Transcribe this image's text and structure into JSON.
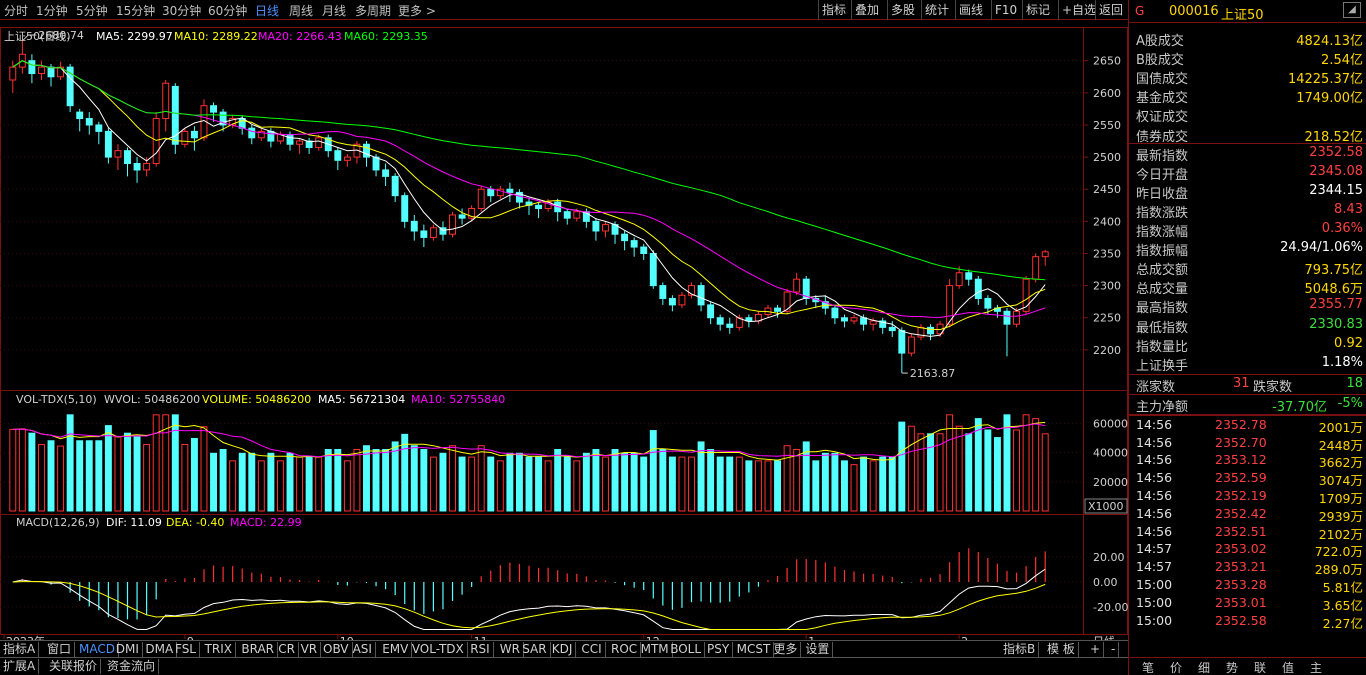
{
  "toolbar": {
    "left_tabs": [
      "分时",
      "1分钟",
      "5分钟",
      "15分钟",
      "30分钟",
      "60分钟",
      "日线",
      "周线",
      "月线",
      "多周期",
      "更多 >"
    ],
    "active_tab": "日线",
    "right_tabs": [
      "指标",
      "叠加",
      "多股",
      "统计",
      "画线",
      "F10",
      "标记",
      "+自选",
      "返回"
    ]
  },
  "price_panel": {
    "title": "上证50(日线)",
    "ma5_label": "MA5: 2299.97",
    "ma10_label": "MA10: 2289.22",
    "ma20_label": "MA20: 2266.43",
    "ma60_label": "MA60: 2293.35",
    "high_marker": "2680.74",
    "low_marker": "2163.87",
    "y_ticks": [
      "2650",
      "2600",
      "2550",
      "2500",
      "2450",
      "2400",
      "2350",
      "2300",
      "2250",
      "2200"
    ]
  },
  "volume_panel": {
    "label_main": "VOL-TDX(5,10)",
    "wvol": "WVOL: 50486200",
    "volume": "VOLUME: 50486200",
    "ma5": "MA5: 56721304",
    "ma10": "MA10: 52755840",
    "y_ticks": [
      "60000",
      "40000",
      "20000"
    ],
    "unit": "X1000"
  },
  "macd_panel": {
    "label_main": "MACD(12,26,9)",
    "dif": "DIF: 11.09",
    "dea": "DEA: -0.40",
    "macd": "MACD: 22.99",
    "y_ticks": [
      "20.00",
      "0.00",
      "-20.00"
    ]
  },
  "x_axis": {
    "labels": [
      "2023年",
      "9",
      "10",
      "11",
      "12",
      "1",
      "2"
    ],
    "period": "日线"
  },
  "bottom_tabs": [
    "指标A",
    "窗口",
    "MACD",
    "DMI",
    "DMA",
    "FSL",
    "TRIX",
    "BRAR",
    "CR",
    "VR",
    "OBV",
    "ASI",
    "EMV",
    "VOL-TDX",
    "RSI",
    "WR",
    "SAR",
    "KDJ",
    "CCI",
    "ROC",
    "MTM",
    "BOLL",
    "PSY",
    "MCST",
    "更多",
    "设置"
  ],
  "bottom_tabs_right": [
    "指标B",
    "模 板",
    "+",
    "-"
  ],
  "bottom_tabs2": [
    "扩展A",
    "关联报价",
    "资金流向"
  ],
  "right_panel": {
    "header_icon": "G",
    "code": "000016",
    "name": "上证50",
    "stats": [
      {
        "label": "A股成交",
        "value": "4824.13亿",
        "color": "yel"
      },
      {
        "label": "B股成交",
        "value": "2.54亿",
        "color": "yel"
      },
      {
        "label": "国债成交",
        "value": "14225.37亿",
        "color": "yel"
      },
      {
        "label": "基金成交",
        "value": "1749.00亿",
        "color": "yel"
      },
      {
        "label": "权证成交",
        "value": "",
        "color": "yel"
      },
      {
        "label": "债券成交",
        "value": "218.52亿",
        "color": "yel"
      },
      {
        "label": "最新指数",
        "value": "2352.58",
        "color": "red"
      },
      {
        "label": "今日开盘",
        "value": "2345.08",
        "color": "red"
      },
      {
        "label": "昨日收盘",
        "value": "2344.15",
        "color": "white"
      },
      {
        "label": "指数涨跌",
        "value": "8.43",
        "color": "red"
      },
      {
        "label": "指数涨幅",
        "value": "0.36%",
        "color": "red"
      },
      {
        "label": "指数振幅",
        "value": "24.94/1.06%",
        "color": "white"
      },
      {
        "label": "总成交额",
        "value": "793.75亿",
        "color": "yel"
      },
      {
        "label": "总成交量",
        "value": "5048.6万",
        "color": "yel"
      },
      {
        "label": "最高指数",
        "value": "2355.77",
        "color": "red"
      },
      {
        "label": "最低指数",
        "value": "2330.83",
        "color": "green"
      },
      {
        "label": "指数量比",
        "value": "0.92",
        "color": "yel"
      },
      {
        "label": "上证换手",
        "value": "1.18%",
        "color": "white"
      }
    ],
    "up_label": "涨家数",
    "up_value": "31",
    "down_label": "跌家数",
    "down_value": "18",
    "main_flow_label": "主力净额",
    "main_flow_value": "-37.70亿",
    "main_flow_pct": "-5%",
    "ticks": [
      {
        "time": "14:56",
        "price": "2352.78",
        "vol": "2001万"
      },
      {
        "time": "14:56",
        "price": "2352.70",
        "vol": "2448万"
      },
      {
        "time": "14:56",
        "price": "2353.12",
        "vol": "3662万"
      },
      {
        "time": "14:56",
        "price": "2352.59",
        "vol": "3074万"
      },
      {
        "time": "14:56",
        "price": "2352.19",
        "vol": "1709万"
      },
      {
        "time": "14:56",
        "price": "2352.42",
        "vol": "2939万"
      },
      {
        "time": "14:56",
        "price": "2352.51",
        "vol": "2102万"
      },
      {
        "time": "14:57",
        "price": "2353.02",
        "vol": "722.0万"
      },
      {
        "time": "14:57",
        "price": "2353.21",
        "vol": "289.0万"
      },
      {
        "time": "15:00",
        "price": "2353.28",
        "vol": "5.81亿"
      },
      {
        "time": "15:00",
        "price": "2353.01",
        "vol": "3.65亿"
      },
      {
        "time": "15:00",
        "price": "2352.58",
        "vol": "2.27亿"
      }
    ],
    "bottom_tabs": [
      "笔",
      "价",
      "细",
      "势",
      "联",
      "值",
      "主"
    ]
  },
  "colors": {
    "up": "#ff3030",
    "down": "#54ffff",
    "ma5": "#ffffff",
    "ma10": "#ffff00",
    "ma20": "#ff00ff",
    "ma60": "#00ff00",
    "grid": "#7a1010"
  },
  "chart_data": {
    "type": "candlestick",
    "ylim": [
      2150,
      2690
    ],
    "candles": [
      [
        2620,
        2640,
        2600,
        2650
      ],
      [
        2640,
        2660,
        2630,
        2680.74
      ],
      [
        2650,
        2630,
        2615,
        2660
      ],
      [
        2630,
        2640,
        2620,
        2650
      ],
      [
        2640,
        2625,
        2610,
        2645
      ],
      [
        2625,
        2640,
        2620,
        2648
      ],
      [
        2640,
        2580,
        2570,
        2645
      ],
      [
        2570,
        2560,
        2540,
        2575
      ],
      [
        2560,
        2550,
        2535,
        2570
      ],
      [
        2550,
        2540,
        2520,
        2555
      ],
      [
        2540,
        2500,
        2490,
        2545
      ],
      [
        2500,
        2510,
        2480,
        2520
      ],
      [
        2510,
        2490,
        2470,
        2515
      ],
      [
        2490,
        2480,
        2460,
        2500
      ],
      [
        2480,
        2490,
        2470,
        2500
      ],
      [
        2490,
        2560,
        2485,
        2570
      ],
      [
        2560,
        2615,
        2540,
        2620
      ],
      [
        2610,
        2520,
        2505,
        2615
      ],
      [
        2520,
        2540,
        2515,
        2545
      ],
      [
        2540,
        2530,
        2510,
        2548
      ],
      [
        2530,
        2580,
        2525,
        2590
      ],
      [
        2580,
        2570,
        2555,
        2585
      ],
      [
        2570,
        2550,
        2540,
        2575
      ],
      [
        2550,
        2560,
        2545,
        2565
      ],
      [
        2560,
        2545,
        2535,
        2565
      ],
      [
        2545,
        2530,
        2520,
        2550
      ],
      [
        2530,
        2540,
        2525,
        2545
      ],
      [
        2540,
        2525,
        2515,
        2545
      ],
      [
        2525,
        2535,
        2520,
        2540
      ],
      [
        2535,
        2520,
        2510,
        2540
      ],
      [
        2520,
        2525,
        2505,
        2530
      ],
      [
        2525,
        2515,
        2505,
        2530
      ],
      [
        2515,
        2530,
        2510,
        2535
      ],
      [
        2530,
        2510,
        2500,
        2535
      ],
      [
        2510,
        2495,
        2480,
        2515
      ],
      [
        2495,
        2500,
        2485,
        2505
      ],
      [
        2500,
        2520,
        2490,
        2525
      ],
      [
        2520,
        2500,
        2485,
        2525
      ],
      [
        2500,
        2480,
        2470,
        2505
      ],
      [
        2480,
        2470,
        2455,
        2490
      ],
      [
        2470,
        2440,
        2430,
        2475
      ],
      [
        2440,
        2400,
        2390,
        2445
      ],
      [
        2400,
        2385,
        2370,
        2410
      ],
      [
        2385,
        2375,
        2360,
        2395
      ],
      [
        2375,
        2390,
        2370,
        2395
      ],
      [
        2390,
        2380,
        2370,
        2400
      ],
      [
        2380,
        2410,
        2375,
        2415
      ],
      [
        2410,
        2405,
        2395,
        2420
      ],
      [
        2405,
        2420,
        2400,
        2425
      ],
      [
        2420,
        2450,
        2415,
        2455
      ],
      [
        2450,
        2440,
        2430,
        2455
      ],
      [
        2440,
        2450,
        2435,
        2455
      ],
      [
        2450,
        2445,
        2430,
        2460
      ],
      [
        2445,
        2430,
        2420,
        2450
      ],
      [
        2430,
        2425,
        2410,
        2435
      ],
      [
        2425,
        2420,
        2405,
        2430
      ],
      [
        2420,
        2430,
        2415,
        2435
      ],
      [
        2430,
        2415,
        2400,
        2435
      ],
      [
        2415,
        2405,
        2395,
        2420
      ],
      [
        2405,
        2415,
        2400,
        2420
      ],
      [
        2415,
        2400,
        2390,
        2420
      ],
      [
        2400,
        2385,
        2370,
        2405
      ],
      [
        2385,
        2395,
        2375,
        2400
      ],
      [
        2395,
        2380,
        2365,
        2400
      ],
      [
        2380,
        2370,
        2355,
        2385
      ],
      [
        2370,
        2360,
        2345,
        2375
      ],
      [
        2360,
        2350,
        2340,
        2365
      ],
      [
        2350,
        2300,
        2295,
        2355
      ],
      [
        2300,
        2280,
        2270,
        2305
      ],
      [
        2280,
        2270,
        2260,
        2285
      ],
      [
        2270,
        2285,
        2265,
        2290
      ],
      [
        2285,
        2300,
        2280,
        2305
      ],
      [
        2300,
        2270,
        2260,
        2305
      ],
      [
        2270,
        2250,
        2240,
        2275
      ],
      [
        2250,
        2240,
        2230,
        2255
      ],
      [
        2240,
        2235,
        2225,
        2250
      ],
      [
        2235,
        2250,
        2230,
        2255
      ],
      [
        2250,
        2245,
        2235,
        2255
      ],
      [
        2245,
        2255,
        2240,
        2260
      ],
      [
        2255,
        2265,
        2250,
        2270
      ],
      [
        2265,
        2260,
        2250,
        2270
      ],
      [
        2260,
        2290,
        2255,
        2295
      ],
      [
        2290,
        2310,
        2285,
        2320
      ],
      [
        2310,
        2280,
        2270,
        2315
      ],
      [
        2280,
        2275,
        2265,
        2285
      ],
      [
        2275,
        2265,
        2255,
        2285
      ],
      [
        2265,
        2250,
        2240,
        2270
      ],
      [
        2250,
        2245,
        2235,
        2255
      ],
      [
        2245,
        2250,
        2240,
        2255
      ],
      [
        2250,
        2240,
        2230,
        2255
      ],
      [
        2240,
        2245,
        2230,
        2250
      ],
      [
        2245,
        2235,
        2225,
        2250
      ],
      [
        2235,
        2230,
        2220,
        2245
      ],
      [
        2230,
        2195,
        2163.87,
        2235
      ],
      [
        2195,
        2220,
        2190,
        2225
      ],
      [
        2220,
        2235,
        2215,
        2240
      ],
      [
        2235,
        2225,
        2215,
        2240
      ],
      [
        2225,
        2240,
        2220,
        2245
      ],
      [
        2240,
        2300,
        2235,
        2310
      ],
      [
        2300,
        2320,
        2295,
        2330
      ],
      [
        2320,
        2310,
        2300,
        2325
      ],
      [
        2310,
        2280,
        2270,
        2315
      ],
      [
        2280,
        2265,
        2255,
        2285
      ],
      [
        2265,
        2260,
        2250,
        2270
      ],
      [
        2260,
        2240,
        2190,
        2265
      ],
      [
        2240,
        2260,
        2235,
        2265
      ],
      [
        2260,
        2310,
        2255,
        2315
      ],
      [
        2310,
        2345,
        2305,
        2350
      ],
      [
        2345.08,
        2352.58,
        2330.83,
        2355.77
      ]
    ]
  }
}
